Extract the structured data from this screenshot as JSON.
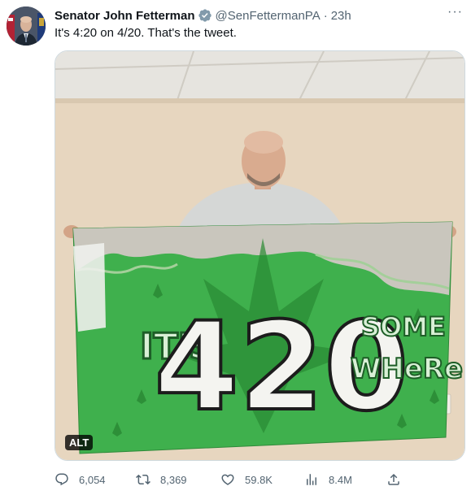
{
  "tweet": {
    "author_name": "Senator John Fetterman",
    "handle": "@SenFettermanPA",
    "separator": "·",
    "time": "23h",
    "text": "It's 4:20 on 4/20. That's the tweet.",
    "verified": true,
    "accent_color": "#829aab"
  },
  "media": {
    "alt_badge": "ALT",
    "flag_text": {
      "its": "IT'S",
      "number": "420",
      "some": "SOME",
      "where": "WHeRe"
    },
    "flag_color": "#3fb04d"
  },
  "actions": {
    "replies": "6,054",
    "retweets": "8,369",
    "likes": "59.8K",
    "views": "8.4M",
    "icons": [
      "reply-icon",
      "retweet-icon",
      "like-icon",
      "views-icon",
      "share-icon"
    ]
  }
}
